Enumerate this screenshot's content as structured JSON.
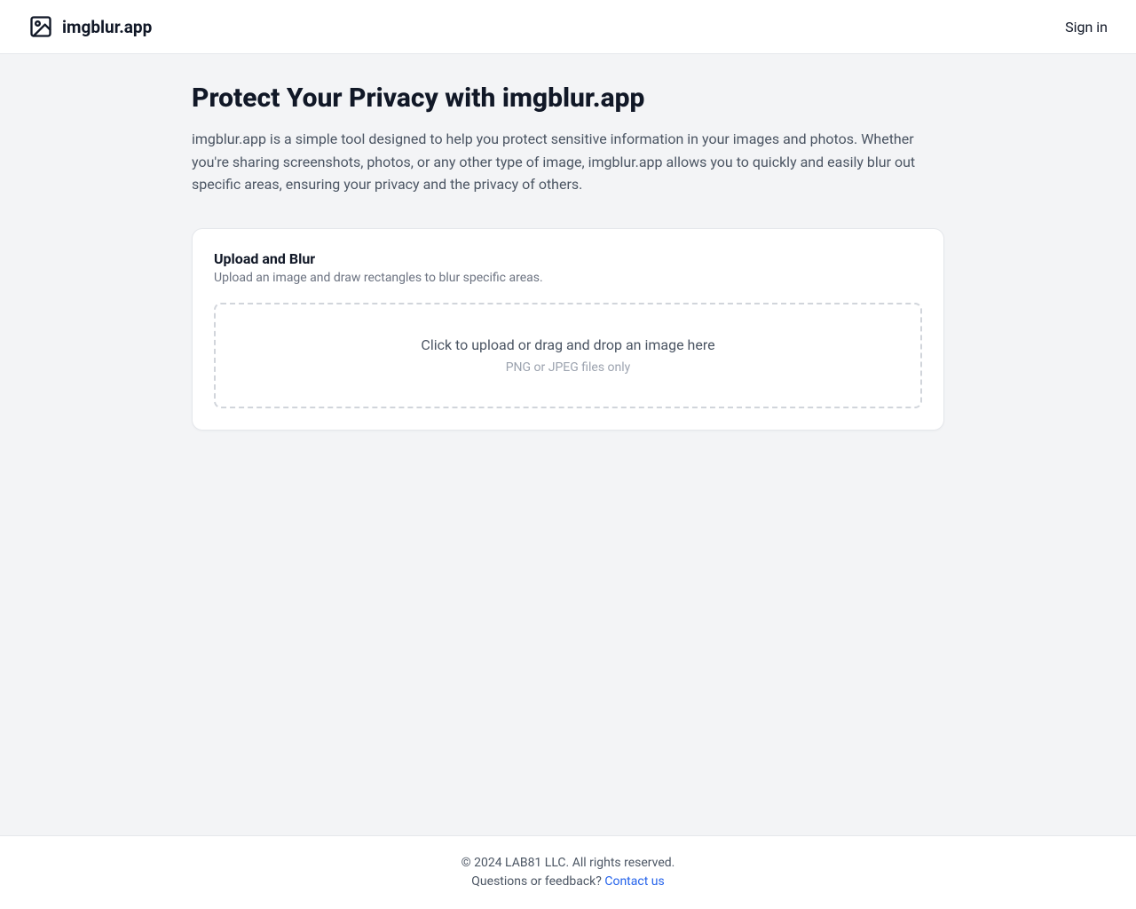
{
  "header": {
    "brand": "imgblur.app",
    "signin": "Sign in"
  },
  "hero": {
    "title": "Protect Your Privacy with imgblur.app",
    "description": "imgblur.app is a simple tool designed to help you protect sensitive information in your images and photos. Whether you're sharing screenshots, photos, or any other type of image, imgblur.app allows you to quickly and easily blur out specific areas, ensuring your privacy and the privacy of others."
  },
  "upload_card": {
    "title": "Upload and Blur",
    "subtitle": "Upload an image and draw rectangles to blur specific areas.",
    "dropzone_primary": "Click to upload or drag and drop an image here",
    "dropzone_secondary": "PNG or JPEG files only"
  },
  "footer": {
    "copyright": "© 2024 LAB81 LLC. All rights reserved.",
    "feedback_prefix": "Questions or feedback? ",
    "contact_label": "Contact us"
  }
}
